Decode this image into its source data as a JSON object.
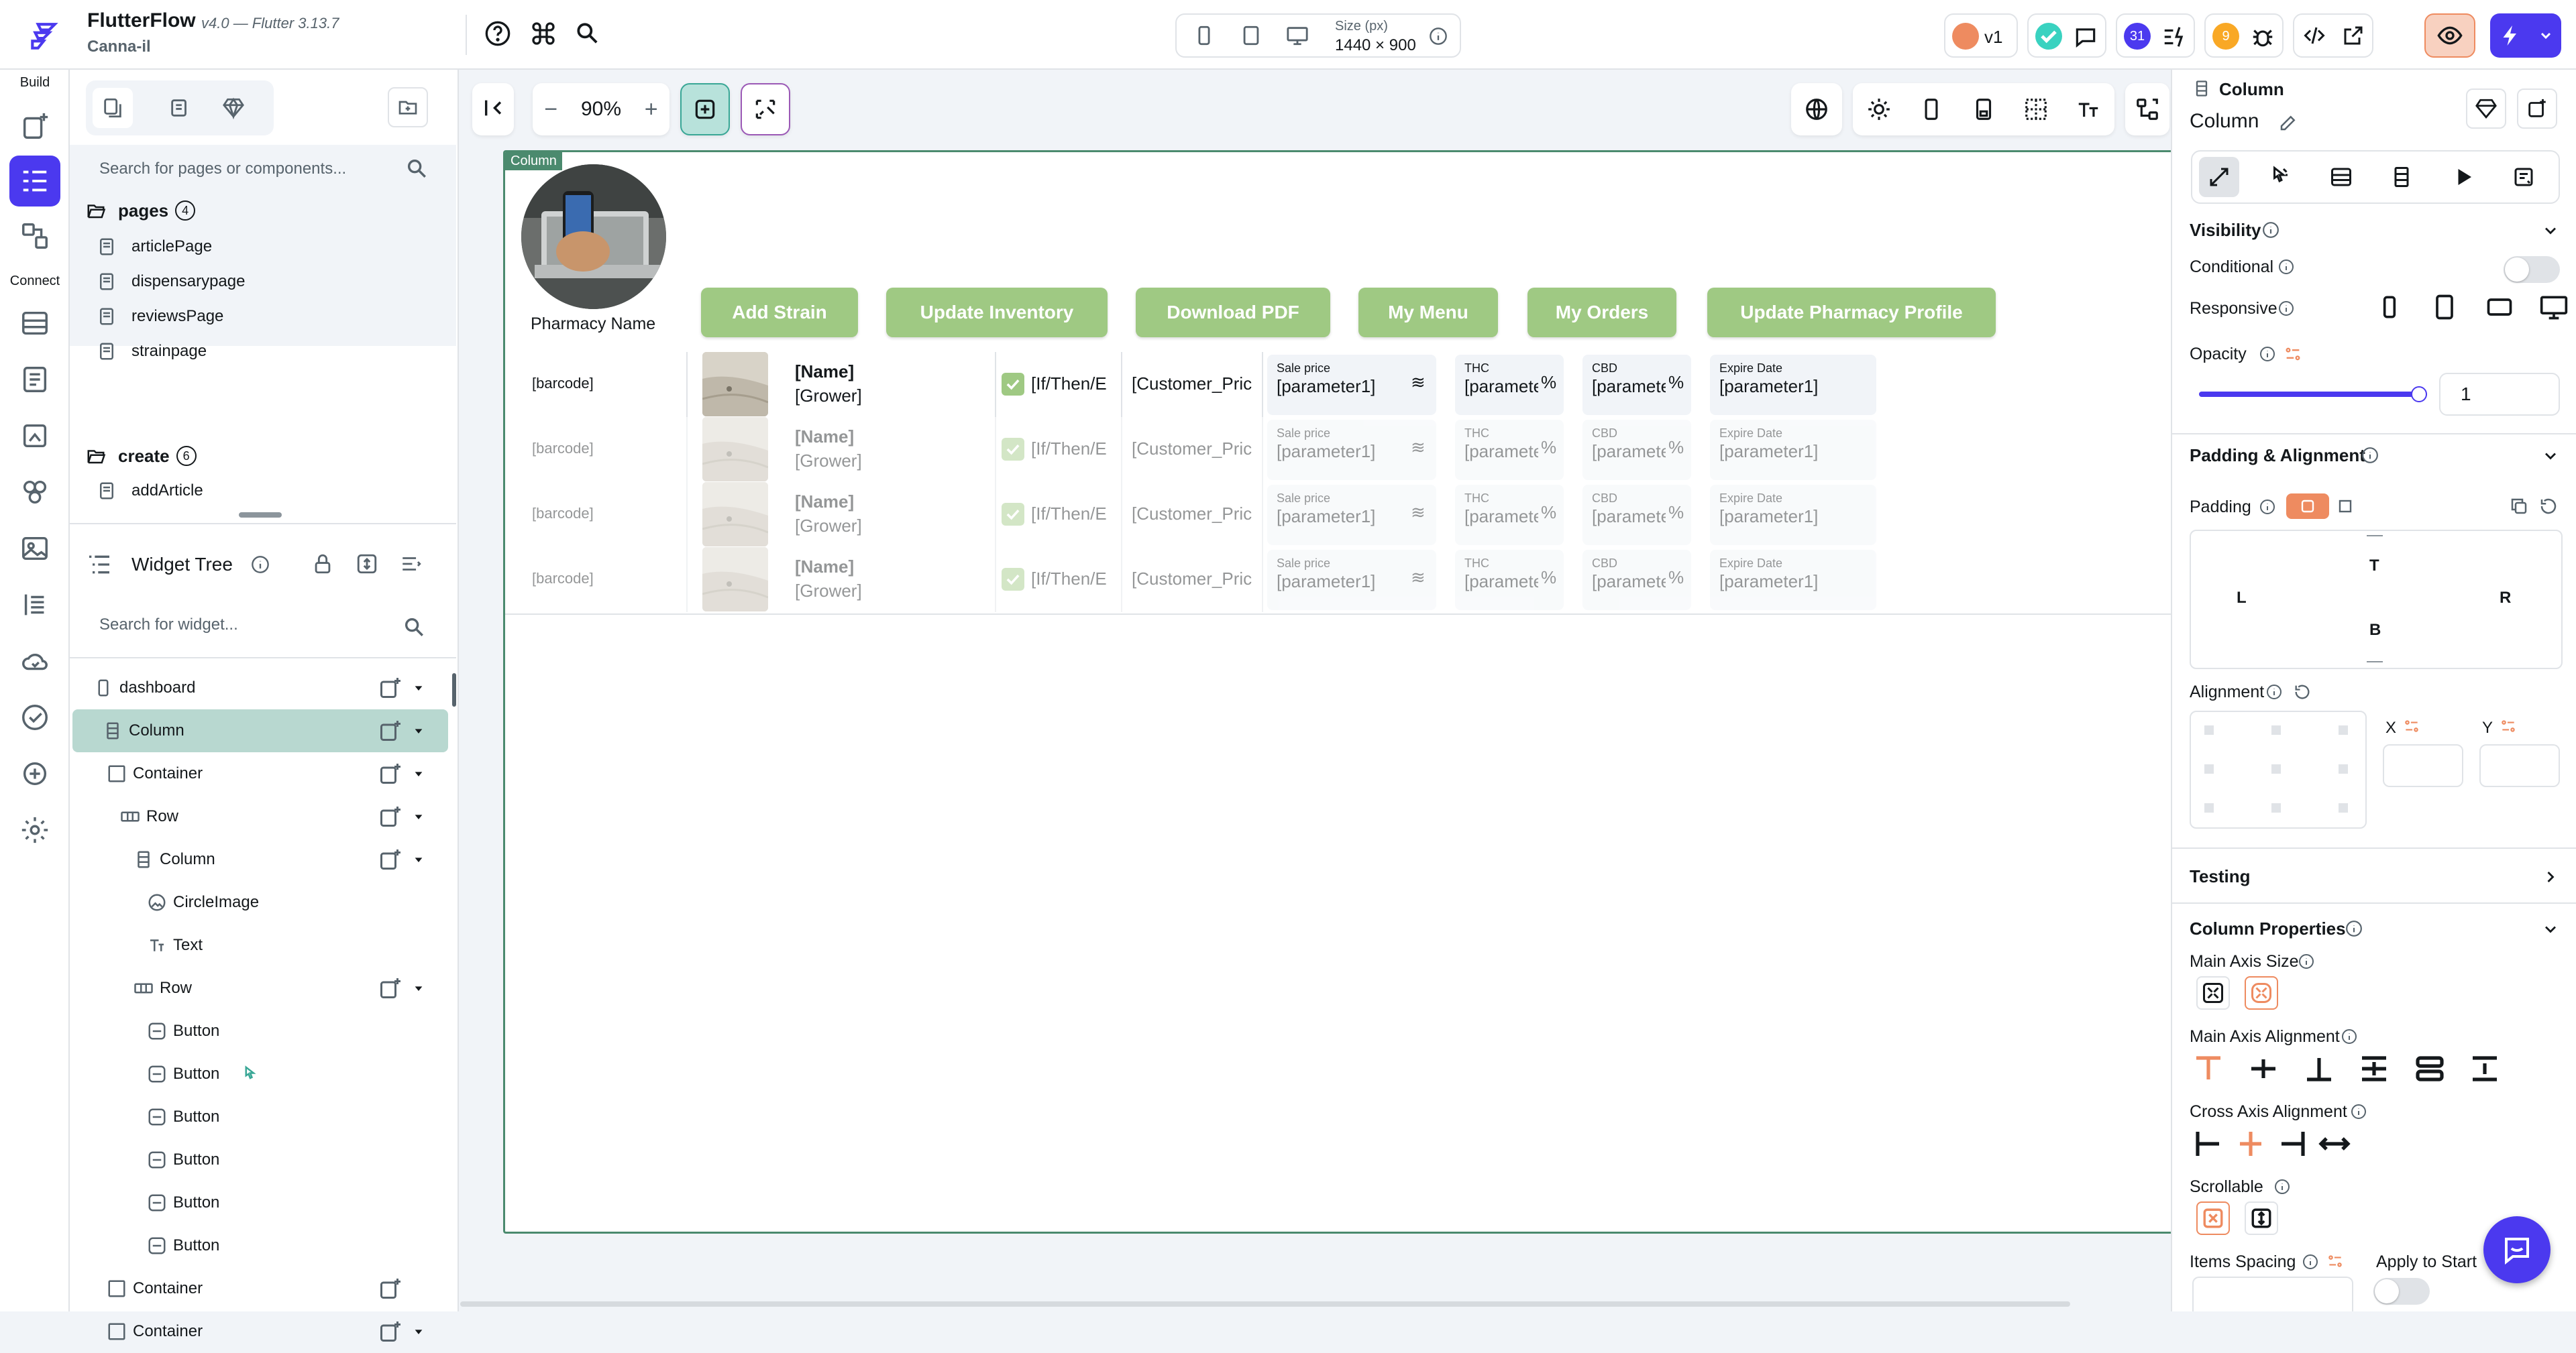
{
  "app": {
    "name": "FlutterFlow",
    "version": "v4.0 — Flutter 3.13.7",
    "project": "Canna-il"
  },
  "topbar": {
    "size_label": "Size (px)",
    "size_value": "1440 × 900",
    "branch": "v1",
    "notif_count": "31",
    "warn_count": "9"
  },
  "rail": {
    "build_label": "Build",
    "connect_label": "Connect"
  },
  "left_panel": {
    "search_pages_placeholder": "Search for pages or components...",
    "pages_folder": {
      "name": "pages",
      "count": "4",
      "items": [
        "articlePage",
        "dispensarypage",
        "reviewsPage",
        "strainpage"
      ]
    },
    "create_folder": {
      "name": "create",
      "count": "6",
      "items": [
        "addArticle"
      ]
    },
    "widget_tree_title": "Widget Tree",
    "search_widget_placeholder": "Search for widget...",
    "tree": [
      {
        "label": "dashboard",
        "icon": "phone-icon"
      },
      {
        "label": "Column",
        "icon": "column-icon",
        "selected": true
      },
      {
        "label": "Container",
        "icon": "container-icon"
      },
      {
        "label": "Row",
        "icon": "row-icon"
      },
      {
        "label": "Column",
        "icon": "column-icon"
      },
      {
        "label": "CircleImage",
        "icon": "circle-image-icon"
      },
      {
        "label": "Text",
        "icon": "text-icon"
      },
      {
        "label": "Row",
        "icon": "row-icon"
      },
      {
        "label": "Button",
        "icon": "button-icon"
      },
      {
        "label": "Button",
        "icon": "button-icon",
        "has_action": true
      },
      {
        "label": "Button",
        "icon": "button-icon"
      },
      {
        "label": "Button",
        "icon": "button-icon"
      },
      {
        "label": "Button",
        "icon": "button-icon"
      },
      {
        "label": "Button",
        "icon": "button-icon"
      },
      {
        "label": "Container",
        "icon": "container-icon"
      },
      {
        "label": "Container",
        "icon": "container-icon"
      }
    ]
  },
  "canvas": {
    "zoom": "90%",
    "frame_tag": "Column",
    "pharmacy_name": "Pharmacy Name",
    "buttons": [
      "Add Strain",
      "Update Inventory",
      "Download PDF",
      "My Menu",
      "My Orders",
      "Update Pharmacy Profile"
    ],
    "rows": [
      {
        "barcode": "[barcode]",
        "name": "[Name]",
        "grower": "[Grower]",
        "cond": "[If/Then/E",
        "price": "[Customer_Pric",
        "sale_label": "Sale price",
        "sale_val": "[parameter1]",
        "thc_label": "THC",
        "thc_val": "[paramete",
        "cbd_label": "CBD",
        "cbd_val": "[paramete",
        "exp_label": "Expire Date",
        "exp_val": "[parameter1]"
      },
      {
        "barcode": "[barcode]",
        "name": "[Name]",
        "grower": "[Grower]",
        "cond": "[If/Then/E",
        "price": "[Customer_Pric",
        "sale_label": "Sale price",
        "sale_val": "[parameter1]",
        "thc_label": "THC",
        "thc_val": "[paramete",
        "cbd_label": "CBD",
        "cbd_val": "[paramete",
        "exp_label": "Expire Date",
        "exp_val": "[parameter1]"
      },
      {
        "barcode": "[barcode]",
        "name": "[Name]",
        "grower": "[Grower]",
        "cond": "[If/Then/E",
        "price": "[Customer_Pric",
        "sale_label": "Sale price",
        "sale_val": "[parameter1]",
        "thc_label": "THC",
        "thc_val": "[paramete",
        "cbd_label": "CBD",
        "cbd_val": "[paramete",
        "exp_label": "Expire Date",
        "exp_val": "[parameter1]"
      },
      {
        "barcode": "[barcode]",
        "name": "[Name]",
        "grower": "[Grower]",
        "cond": "[If/Then/E",
        "price": "[Customer_Pric",
        "sale_label": "Sale price",
        "sale_val": "[parameter1]",
        "thc_label": "THC",
        "thc_val": "[paramete",
        "cbd_label": "CBD",
        "cbd_val": "[paramete",
        "exp_label": "Expire Date",
        "exp_val": "[parameter1]"
      }
    ],
    "sale_suffix": "≋",
    "pct_suffix": "%"
  },
  "props": {
    "widget_type": "Column",
    "widget_name": "Column",
    "visibility": "Visibility",
    "conditional": "Conditional",
    "responsive": "Responsive",
    "opacity": "Opacity",
    "opacity_value": "1",
    "opacity_fraction": 1,
    "padding_alignment": "Padding & Alignment",
    "padding": "Padding",
    "pad_t": "T",
    "pad_l": "L",
    "pad_r": "R",
    "pad_b": "B",
    "alignment": "Alignment",
    "x_label": "X",
    "y_label": "Y",
    "testing": "Testing",
    "column_properties": "Column Properties",
    "main_axis_size": "Main Axis Size",
    "main_axis_alignment": "Main Axis Alignment",
    "cross_axis_alignment": "Cross Axis Alignment",
    "scrollable": "Scrollable",
    "items_spacing": "Items Spacing",
    "apply_to_start": "Apply to Start"
  },
  "colors": {
    "accent": "#4b39ef",
    "selected": "#b8d8d0",
    "green_button": "#9fc983",
    "orange": "#ee8b60"
  }
}
